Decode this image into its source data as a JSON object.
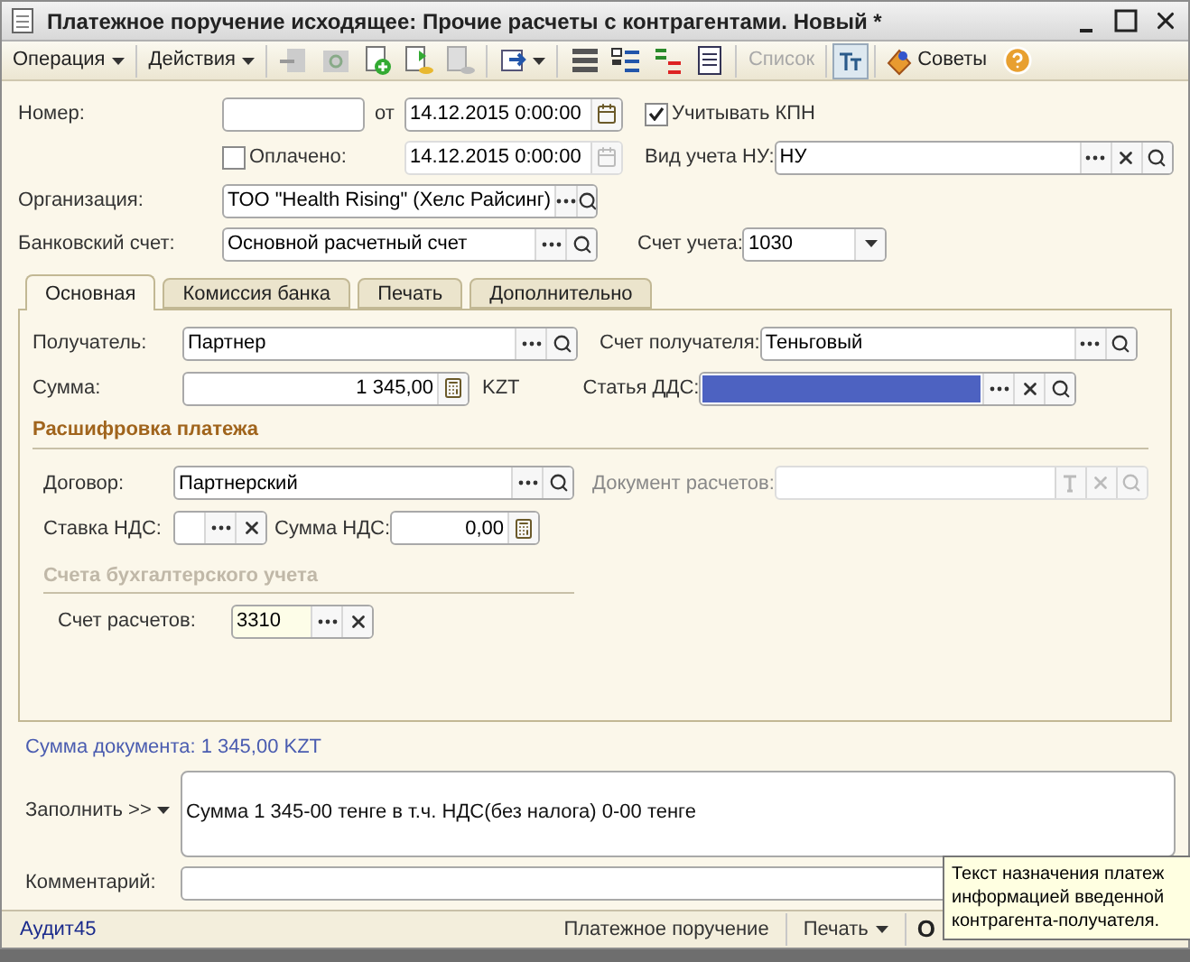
{
  "window": {
    "title": "Платежное поручение исходящее: Прочие расчеты с контрагентами. Новый *"
  },
  "toolbar": {
    "menus": [
      "Операция",
      "Действия"
    ],
    "list_button": {
      "label": "Список",
      "disabled": true
    },
    "tips_button": {
      "label": "Советы"
    }
  },
  "header": {
    "number": {
      "label": "Номер:"
    },
    "date_label": "от",
    "date": {
      "value": "14.12.2015  0:00:00"
    },
    "kpn": {
      "label": "Учитывать КПН",
      "checked": true
    },
    "paid": {
      "label": "Оплачено:",
      "checked": false
    },
    "paid_date": {
      "value": "14.12.2015  0:00:00",
      "disabled": true
    },
    "tax_accounting": {
      "label": "Вид учета НУ:",
      "value": "НУ"
    },
    "organization": {
      "label": "Организация:",
      "value": "ТОО \"Health Rising\" (Хелс Райсинг)"
    },
    "bank_account": {
      "label": "Банковский счет:",
      "value": "Основной расчетный счет"
    },
    "account": {
      "label": "Счет учета:",
      "value": "1030"
    }
  },
  "tabs": [
    {
      "label": "Основная",
      "selected": true
    },
    {
      "label": "Комиссия банка",
      "selected": false
    },
    {
      "label": "Печать",
      "selected": false
    },
    {
      "label": "Дополнительно",
      "selected": false
    }
  ],
  "main_tab": {
    "recipient": {
      "label": "Получатель:",
      "value": "Партнер"
    },
    "recipient_account": {
      "label": "Счет получателя:",
      "value": "Теньговый"
    },
    "amount": {
      "label": "Сумма:",
      "value": "1 345,00",
      "currency": "KZT"
    },
    "cash_flow_item": {
      "label": "Статья ДДС:",
      "selected": true
    },
    "breakdown_title": "Расшифровка платежа",
    "contract": {
      "label": "Договор:",
      "value": "Партнерский"
    },
    "settlement_document": {
      "label": "Документ расчетов:",
      "disabled": true
    },
    "vat_rate": {
      "label": "Ставка НДС:"
    },
    "vat_amount": {
      "label": "Сумма НДС:",
      "value": "0,00"
    },
    "accounts_title": {
      "label": "Счета бухгалтерского учета",
      "disabled": true
    },
    "settlement_account": {
      "label": "Счет расчетов:",
      "value": "3310"
    }
  },
  "document_total": "Сумма документа: 1 345,00 KZT",
  "fill_button": "Заполнить >>",
  "purpose": "Сумма 1 345-00 тенге в т.ч. НДС(без налога) 0-00 тенге",
  "comment": {
    "label": "Комментарий:"
  },
  "status_bar": {
    "author": "Аудит45",
    "buttons": [
      {
        "label": "Платежное поручение",
        "kind": "plain"
      },
      {
        "label": "Печать",
        "kind": "menu"
      }
    ],
    "ok_button": "О"
  },
  "tooltip": {
    "lines": [
      "Текст назначения платеж",
      "информацией введенной",
      "контрагента-получателя."
    ]
  }
}
